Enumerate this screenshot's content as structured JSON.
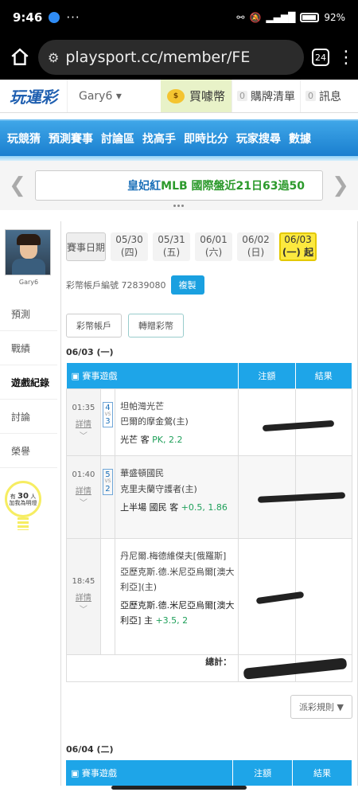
{
  "status": {
    "time": "9:46",
    "more": "···",
    "battery": "92%"
  },
  "browser": {
    "url": "playsport.cc/member/FE",
    "tab_count": "24"
  },
  "header": {
    "logo": "玩運彩",
    "user": "Gary6 ▾",
    "buy_coin": "買噱幣",
    "cart_count": "0",
    "cart": "購牌清單",
    "msg_count": "0",
    "msg": "訊息"
  },
  "nav": [
    "玩競猜",
    "預測賽事",
    "討論區",
    "找高手",
    "即時比分",
    "玩家搜尋",
    "數據"
  ],
  "banner": {
    "prefix": "皇妃紅",
    "text": " MLB 國際盤近21日63過50"
  },
  "sidebar": {
    "avatar_name": "Gary6",
    "links": [
      "預測",
      "戰績",
      "遊戲紀錄",
      "討論",
      "榮譽"
    ],
    "bulb_prefix": "有",
    "bulb_count": "30",
    "bulb_unit": "人",
    "bulb_text": "加我為明燈"
  },
  "dates": {
    "label": "賽事日期",
    "items": [
      {
        "date": "05/30",
        "dow": "(四)"
      },
      {
        "date": "05/31",
        "dow": "(五)"
      },
      {
        "date": "06/01",
        "dow": "(六)"
      },
      {
        "date": "06/02",
        "dow": "(日)"
      },
      {
        "date": "06/03",
        "dow": "(一) 起"
      }
    ]
  },
  "account": {
    "label": "彩幣帳戶編號 72839080",
    "copy": "複製"
  },
  "buttons": {
    "wallet": "彩幣帳戶",
    "transfer": "轉贈彩幣"
  },
  "day1": {
    "header": "06/03 (一)",
    "columns": [
      "賽事遊戲",
      "注額",
      "結果"
    ],
    "games": [
      {
        "time": "01:35",
        "detail": "詳情",
        "s1": "4",
        "s2": "3",
        "team1": "坦帕灣光芒",
        "team2": "巴爾的摩金鶯(主)",
        "pick": "光芒 客",
        "odd": "PK, 2.2"
      },
      {
        "time": "01:40",
        "detail": "詳情",
        "s1": "5",
        "s2": "2",
        "team1": "華盛頓國民",
        "team2": "克里夫蘭守護者(主)",
        "pick": "上半場 國民 客",
        "odd": "+0.5, 1.86"
      },
      {
        "time": "18:45",
        "detail": "詳情",
        "s1": "",
        "s2": "",
        "team1": "丹尼爾.梅德維傑夫[俄羅斯]",
        "team2": "亞歷克斯.德.米尼亞烏爾[澳大利亞](主)",
        "pick": "亞歷克斯.德.米尼亞烏爾[澳大利亞] 主",
        "odd": "+3.5, 2"
      }
    ],
    "total_label": "總計："
  },
  "rules": "派彩規則 ▼",
  "day2": {
    "header": "06/04 (二)",
    "columns": [
      "賽事遊戲",
      "注額",
      "結果"
    ]
  }
}
